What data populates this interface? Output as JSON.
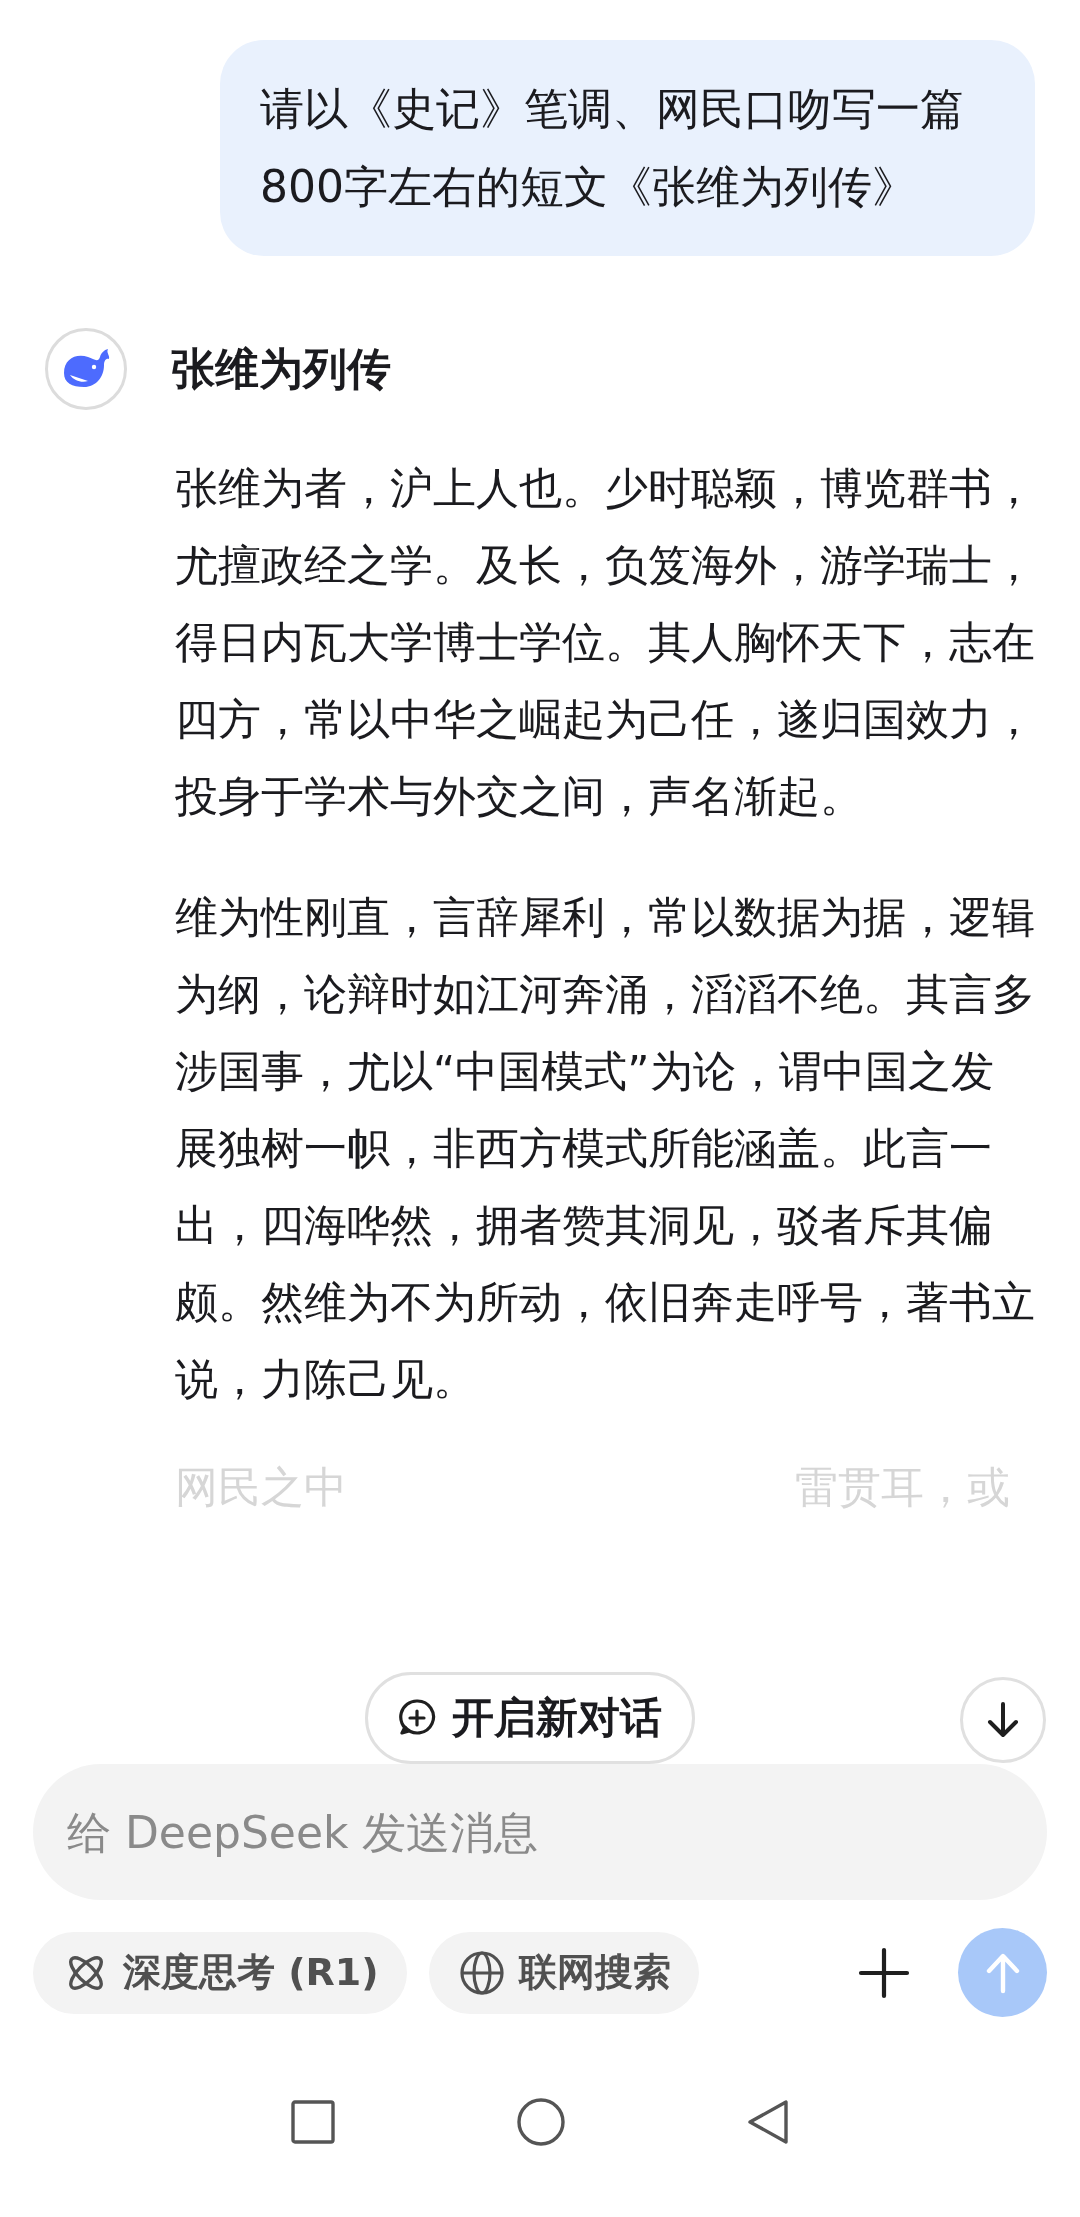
{
  "user_message": "请以《史记》笔调、网民口吻写一篇800字左右的短文《张维为列传》",
  "reply": {
    "title": "张维为列传",
    "paragraphs": [
      "张维为者，沪上人也。少时聪颖，博览群书，尤擅政经之学。及长，负笈海外，游学瑞士，得日内瓦大学博士学位。其人胸怀天下，志在四方，常以中华之崛起为己任，遂归国效力，投身于学术与外交之间，声名渐起。",
      "维为性刚直，言辞犀利，常以数据为据，逻辑为纲，论辩时如江河奔涌，滔滔不绝。其言多涉国事，尤以“中国模式”为论，谓中国之发展独树一帜，非西方模式所能涵盖。此言一出，四海哗然，拥者赞其洞见，驳者斥其偏颇。然维为不为所动，依旧奔走呼号，著书立说，力陈己见。"
    ],
    "faded_line": {
      "left": "网民之中",
      "right": "雷贯耳，或"
    }
  },
  "new_chat_button": "开启新对话",
  "input": {
    "placeholder": "给 DeepSeek 发送消息"
  },
  "toggles": [
    {
      "kind": "think",
      "label": "深度思考 (R1)",
      "selected": false
    },
    {
      "kind": "search",
      "label": "联网搜索",
      "selected": false
    }
  ],
  "send_enabled": false
}
